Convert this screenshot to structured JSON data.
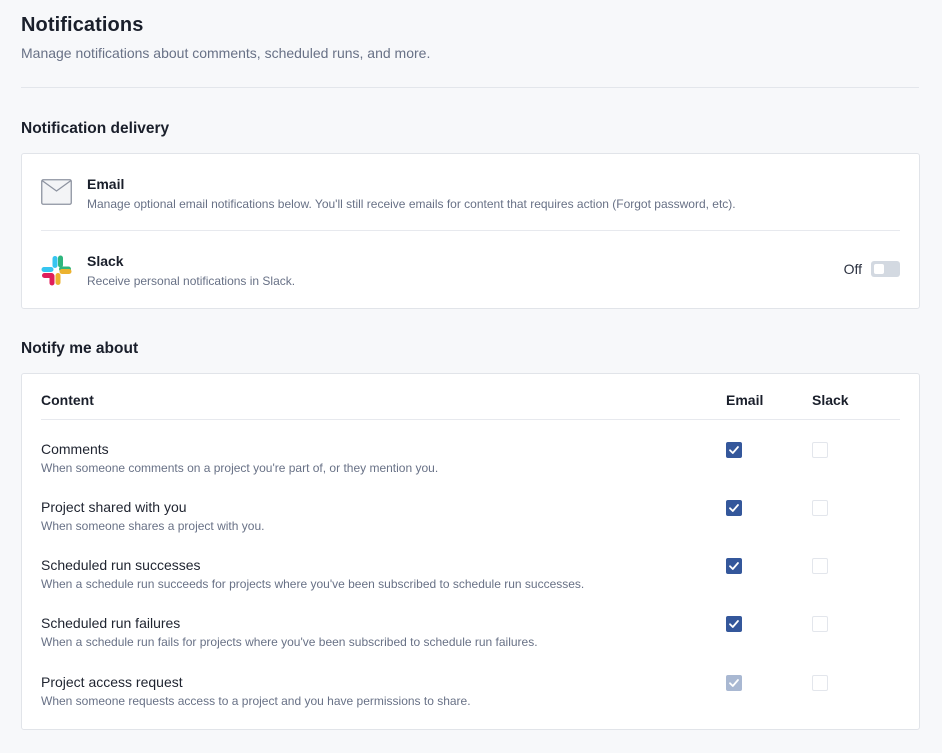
{
  "header": {
    "title": "Notifications",
    "subtitle": "Manage notifications about comments, scheduled runs, and more."
  },
  "delivery": {
    "section_title": "Notification delivery",
    "email": {
      "name": "Email",
      "description": "Manage optional email notifications below. You'll still receive emails for content that requires action (Forgot password, etc).",
      "icon": "envelope-icon"
    },
    "slack": {
      "name": "Slack",
      "description": "Receive personal notifications in Slack.",
      "icon": "slack-logo-icon",
      "toggle_label": "Off",
      "enabled": false
    }
  },
  "notify": {
    "section_title": "Notify me about",
    "columns": {
      "content": "Content",
      "email": "Email",
      "slack": "Slack"
    },
    "rows": [
      {
        "name": "Comments",
        "description": "When someone comments on a project you're part of, or they mention you.",
        "email": true,
        "slack": false,
        "email_disabled": false
      },
      {
        "name": "Project shared with you",
        "description": "When someone shares a project with you.",
        "email": true,
        "slack": false,
        "email_disabled": false
      },
      {
        "name": "Scheduled run successes",
        "description": "When a schedule run succeeds for projects where you've been subscribed to schedule run successes.",
        "email": true,
        "slack": false,
        "email_disabled": false
      },
      {
        "name": "Scheduled run failures",
        "description": "When a schedule run fails for projects where you've been subscribed to schedule run failures.",
        "email": true,
        "slack": false,
        "email_disabled": false
      },
      {
        "name": "Project access request",
        "description": "When someone requests access to a project and you have permissions to share.",
        "email": true,
        "slack": false,
        "email_disabled": true
      }
    ]
  },
  "colors": {
    "accent": "#34579b",
    "accent_disabled": "#a9b8d2",
    "toggle_off": "#d3d9e1",
    "background": "#f7f8fa"
  }
}
